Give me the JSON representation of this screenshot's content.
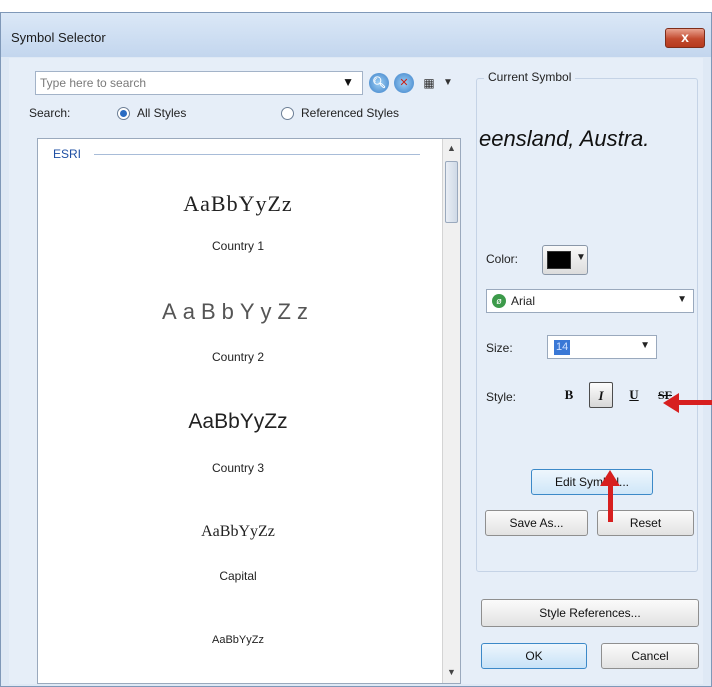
{
  "window": {
    "title": "Symbol Selector",
    "close_glyph": "x"
  },
  "search": {
    "placeholder": "Type here to search",
    "label": "Search:",
    "options": [
      {
        "label": "All Styles",
        "selected": true
      },
      {
        "label": "Referenced Styles",
        "selected": false
      }
    ]
  },
  "toolbar": {
    "icons": [
      "search-icon",
      "clear-search-icon",
      "view-mode-icon"
    ],
    "view_glyph": "▦",
    "dropdown_glyph": "▼"
  },
  "style_list": {
    "group": "ESRI",
    "items": [
      {
        "sample": "AaBbYyZz",
        "name": "Country 1"
      },
      {
        "sample": "AaBbYyZz",
        "name": "Country 2"
      },
      {
        "sample": "AaBbYyZz",
        "name": "Country 3"
      },
      {
        "sample": "AaBbYyZz",
        "name": "Capital"
      },
      {
        "sample": "AaBbYyZz",
        "name": ""
      }
    ]
  },
  "current_symbol": {
    "label": "Current Symbol",
    "preview": "eensland, Austra.",
    "color_label": "Color:",
    "color": "#000000",
    "font": "Arial",
    "size_label": "Size:",
    "size": "14",
    "style_label": "Style:",
    "style_buttons": {
      "bold": "B",
      "italic": "I",
      "underline": "U",
      "strikethrough": "SF"
    },
    "italic_active": true
  },
  "buttons": {
    "edit_symbol": "Edit Symbol...",
    "save_as": "Save As...",
    "reset": "Reset",
    "style_references": "Style References...",
    "ok": "OK",
    "cancel": "Cancel"
  },
  "annotations": {
    "arrow_color": "#d71f1f"
  }
}
